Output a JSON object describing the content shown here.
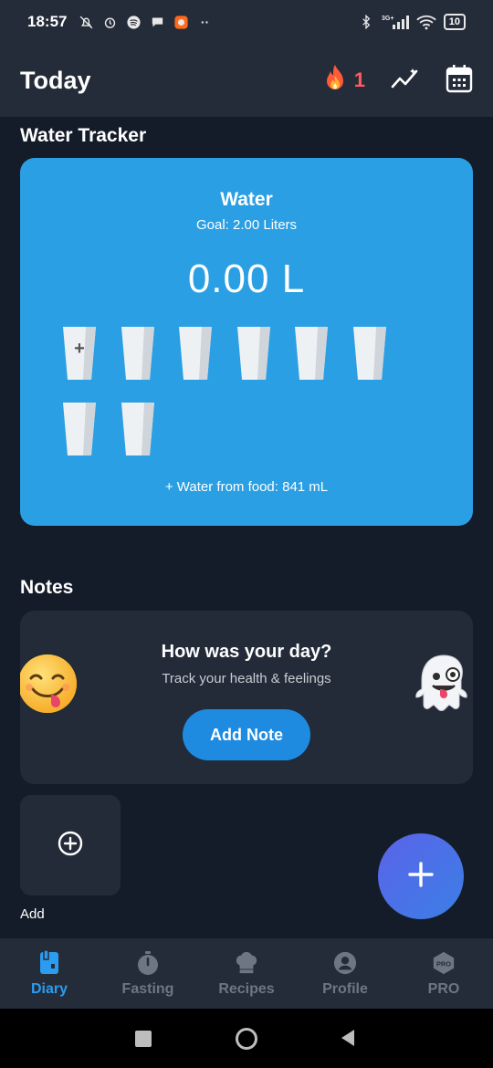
{
  "status_bar": {
    "time": "18:57",
    "battery": "10",
    "network": "3G+"
  },
  "header": {
    "title": "Today",
    "streak_count": "1",
    "icons": [
      "fire-icon",
      "trend-icon",
      "calendar-icon"
    ]
  },
  "water_tracker": {
    "section_title": "Water Tracker",
    "title": "Water",
    "goal": "Goal: 2.00 Liters",
    "amount": "0.00 L",
    "glass_count": 8,
    "food_water": "+ Water from food: 841 mL",
    "card_color": "#2a9fe3"
  },
  "notes": {
    "section_title": "Notes",
    "question": "How was your day?",
    "subtitle": "Track your health & feelings",
    "button_label": "Add Note"
  },
  "add_tile": {
    "label": "Add"
  },
  "bottom_nav": {
    "items": [
      {
        "label": "Diary",
        "active": true
      },
      {
        "label": "Fasting",
        "active": false
      },
      {
        "label": "Recipes",
        "active": false
      },
      {
        "label": "Profile",
        "active": false
      },
      {
        "label": "PRO",
        "active": false
      }
    ],
    "active_color": "#2b9cf0",
    "inactive_color": "#6f7683"
  }
}
